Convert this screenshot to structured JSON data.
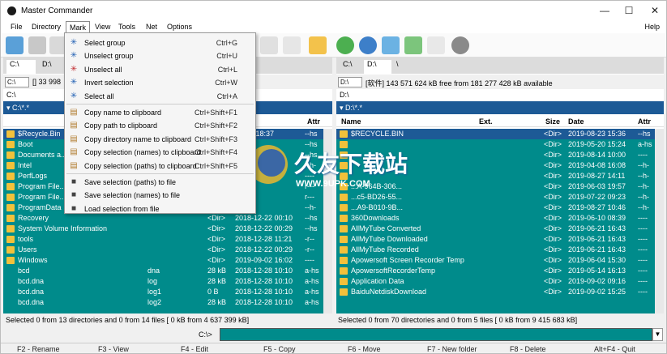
{
  "window": {
    "title": "Master Commander"
  },
  "menubar": {
    "items": [
      "File",
      "Directory",
      "Mark",
      "View",
      "Tools",
      "Net",
      "Options"
    ],
    "help": "Help"
  },
  "mark_menu": [
    {
      "label": "Select group",
      "shortcut": "Ctrl+G",
      "icon": "select-group-icon"
    },
    {
      "label": "Unselect group",
      "shortcut": "Ctrl+U",
      "icon": "unselect-group-icon"
    },
    {
      "label": "Unselect all",
      "shortcut": "Ctrl+L",
      "icon": "unselect-all-icon"
    },
    {
      "label": "Invert selection",
      "shortcut": "Ctrl+W",
      "icon": "invert-selection-icon"
    },
    {
      "label": "Select all",
      "shortcut": "Ctrl+A",
      "icon": "select-all-icon"
    },
    {
      "label": "Copy name to clipboard",
      "shortcut": "Ctrl+Shift+F1",
      "icon": "clipboard-icon"
    },
    {
      "label": "Copy path to clipboard",
      "shortcut": "Ctrl+Shift+F2",
      "icon": "clipboard-icon"
    },
    {
      "label": "Copy directory name to clipboard",
      "shortcut": "Ctrl+Shift+F3",
      "icon": "clipboard-icon"
    },
    {
      "label": "Copy selection (names) to clipboard",
      "shortcut": "Ctrl+Shift+F4",
      "icon": "clipboard-icon"
    },
    {
      "label": "Copy selection (paths) to clipboard",
      "shortcut": "Ctrl+Shift+F5",
      "icon": "clipboard-icon"
    },
    {
      "label": "Save selection (paths) to file",
      "shortcut": "",
      "icon": "save-icon"
    },
    {
      "label": "Save selection (names) to file",
      "shortcut": "",
      "icon": "save-icon"
    },
    {
      "label": "Load selection from file",
      "shortcut": "",
      "icon": "load-icon"
    }
  ],
  "left": {
    "tabs": [
      "C:\\",
      "D:\\"
    ],
    "drive": "C:\\",
    "drive_info": "[] 33 998",
    "path": "C:\\",
    "filter": "▾ C:\\*.*",
    "headers": {
      "attr": "Attr"
    },
    "rows": [
      {
        "name": "$Recycle.Bin",
        "ext": "",
        "size": "",
        "date": "01-07 18:37",
        "attr": "--hs",
        "folder": true
      },
      {
        "name": "Boot",
        "ext": "",
        "size": "",
        "date": "",
        "attr": "--hs",
        "folder": true
      },
      {
        "name": "Documents a...",
        "ext": "",
        "size": "",
        "date": "",
        "attr": "--hs",
        "folder": true
      },
      {
        "name": "Intel",
        "ext": "",
        "size": "",
        "date": "",
        "attr": "--h-",
        "folder": true
      },
      {
        "name": "PerfLogs",
        "ext": "",
        "size": "",
        "date": "",
        "attr": "----",
        "folder": true
      },
      {
        "name": "Program File...",
        "ext": "",
        "size": "",
        "date": "",
        "attr": "r---",
        "folder": true
      },
      {
        "name": "Program File...",
        "ext": "",
        "size": "",
        "date": "",
        "attr": "r---",
        "folder": true
      },
      {
        "name": "ProgramData",
        "ext": "",
        "size": "",
        "date": "",
        "attr": "--h-",
        "folder": true
      },
      {
        "name": "Recovery",
        "ext": "",
        "size": "<Dir>",
        "date": "2018-12-22 00:10",
        "attr": "--hs",
        "folder": true
      },
      {
        "name": "System Volume Information",
        "ext": "",
        "size": "<Dir>",
        "date": "2018-12-22 00:29",
        "attr": "--hs",
        "folder": true
      },
      {
        "name": "tools",
        "ext": "",
        "size": "<Dir>",
        "date": "2018-12-28 11:21",
        "attr": "-r--",
        "folder": true
      },
      {
        "name": "Users",
        "ext": "",
        "size": "<Dir>",
        "date": "2018-12-22 00:29",
        "attr": "-r--",
        "folder": true
      },
      {
        "name": "Windows",
        "ext": "",
        "size": "<Dir>",
        "date": "2019-09-02 16:02",
        "attr": "----",
        "folder": true
      },
      {
        "name": "bcd",
        "ext": "dna",
        "size": "28 kB",
        "date": "2018-12-28 10:10",
        "attr": "a-hs",
        "folder": false
      },
      {
        "name": "bcd.dna",
        "ext": "log",
        "size": "28 kB",
        "date": "2018-12-28 10:10",
        "attr": "a-hs",
        "folder": false
      },
      {
        "name": "bcd.dna",
        "ext": "log1",
        "size": "0 B",
        "date": "2018-12-28 10:10",
        "attr": "a-hs",
        "folder": false
      },
      {
        "name": "bcd.dna",
        "ext": "log2",
        "size": "28 kB",
        "date": "2018-12-28 10:10",
        "attr": "a-hs",
        "folder": false
      }
    ],
    "status": "Selected 0 from 13 directories and 0 from 14 files [ 0 kB from 4 637 399 kB]"
  },
  "right": {
    "tabs": [
      "C:\\",
      "D:\\",
      "\\"
    ],
    "drive": "D:\\",
    "drive_info": "[软件] 143 571 624 kB free from 181 277 428 kB available",
    "path": "D:\\",
    "filter": "▾ D:\\*.*",
    "headers": {
      "name": "Name",
      "ext": "Ext.",
      "size": "Size",
      "date": "Date",
      "attr": "Attr"
    },
    "rows": [
      {
        "name": "$RECYCLE.BIN",
        "ext": "",
        "size": "<Dir>",
        "date": "2019-08-23 15:36",
        "attr": "--hs",
        "folder": true
      },
      {
        "name": "",
        "ext": "",
        "size": "<Dir>",
        "date": "2019-05-20 15:24",
        "attr": "a-hs",
        "folder": true
      },
      {
        "name": "",
        "ext": "",
        "size": "<Dir>",
        "date": "2019-08-14 10:00",
        "attr": "----",
        "folder": true
      },
      {
        "name": "",
        "ext": "",
        "size": "<Dir>",
        "date": "2019-04-08 16:08",
        "attr": "--h-",
        "folder": true
      },
      {
        "name": "",
        "ext": "",
        "size": "<Dir>",
        "date": "2019-08-27 14:11",
        "attr": "--h-",
        "folder": true
      },
      {
        "name": "...A-964B-306...",
        "ext": "",
        "size": "<Dir>",
        "date": "2019-06-03 19:57",
        "attr": "--h-",
        "folder": true
      },
      {
        "name": "...c5-BD26-55...",
        "ext": "",
        "size": "<Dir>",
        "date": "2019-07-22 09:23",
        "attr": "--h-",
        "folder": true
      },
      {
        "name": "...A9-B010-9B...",
        "ext": "",
        "size": "<Dir>",
        "date": "2019-08-27 10:46",
        "attr": "--h-",
        "folder": true
      },
      {
        "name": "360Downloads",
        "ext": "",
        "size": "<Dir>",
        "date": "2019-06-10 08:39",
        "attr": "----",
        "folder": true
      },
      {
        "name": "AllMyTube Converted",
        "ext": "",
        "size": "<Dir>",
        "date": "2019-06-21 16:43",
        "attr": "----",
        "folder": true
      },
      {
        "name": "AllMyTube Downloaded",
        "ext": "",
        "size": "<Dir>",
        "date": "2019-06-21 16:43",
        "attr": "----",
        "folder": true
      },
      {
        "name": "AllMyTube Recorded",
        "ext": "",
        "size": "<Dir>",
        "date": "2019-06-21 16:43",
        "attr": "----",
        "folder": true
      },
      {
        "name": "Apowersoft Screen Recorder Temp",
        "ext": "",
        "size": "<Dir>",
        "date": "2019-06-04 15:30",
        "attr": "----",
        "folder": true
      },
      {
        "name": "ApowersoftRecorderTemp",
        "ext": "",
        "size": "<Dir>",
        "date": "2019-05-14 16:13",
        "attr": "----",
        "folder": true
      },
      {
        "name": "Application Data",
        "ext": "",
        "size": "<Dir>",
        "date": "2019-09-02 09:16",
        "attr": "----",
        "folder": true
      },
      {
        "name": "BaiduNetdiskDownload",
        "ext": "",
        "size": "<Dir>",
        "date": "2019-09-02 15:25",
        "attr": "----",
        "folder": true
      }
    ],
    "status": "Selected 0 from 70 directories and 0 from 5 files [ 0 kB from 9 415 683 kB]"
  },
  "cmdline": {
    "label": "C:\\>"
  },
  "fkeys": [
    "F2 - Rename",
    "F3 - View",
    "F4 - Edit",
    "F5 - Copy",
    "F6 - Move",
    "F7 - New folder",
    "F8 - Delete",
    "Alt+F4 - Quit"
  ],
  "watermark": {
    "text": "久友下载站",
    "url": "WWW.9UPK.COM"
  },
  "colors": {
    "file_bg": "#008b8b",
    "filter_bar": "#1d5a96",
    "folder": "#f2c13b"
  }
}
